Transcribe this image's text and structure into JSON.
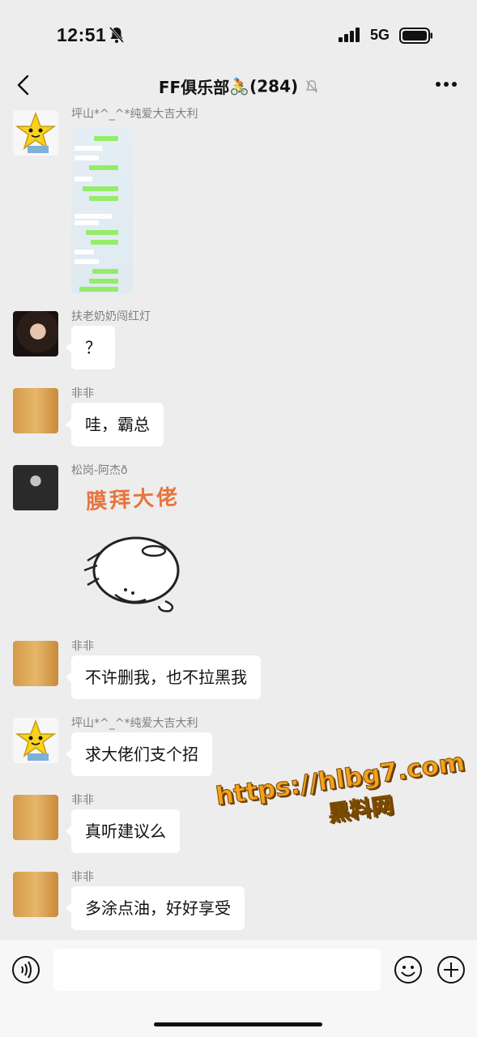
{
  "status_bar": {
    "time": "12:51",
    "network": "5G"
  },
  "header": {
    "group_name": "FF俱乐部",
    "member_count": "(284)",
    "emoji": "🚴"
  },
  "messages": [
    {
      "sender": "坪山*^_^*纯爱大吉大利",
      "type": "image",
      "avatar": "star-avatar"
    },
    {
      "sender": "扶老奶奶闯红灯",
      "type": "text",
      "text": "？",
      "avatar": "woman-avatar"
    },
    {
      "sender": "非非",
      "type": "text",
      "text": "哇，霸总",
      "avatar": "cat-avatar"
    },
    {
      "sender": "松岗-阿杰ð",
      "type": "sticker",
      "sticker_text": "膜拜大佬",
      "avatar": "man-avatar"
    },
    {
      "sender": "非非",
      "type": "text",
      "text": "不许删我，也不拉黑我",
      "avatar": "cat-avatar"
    },
    {
      "sender": "坪山*^_^*纯爱大吉大利",
      "type": "text",
      "text": "求大佬们支个招",
      "avatar": "star-avatar"
    },
    {
      "sender": "非非",
      "type": "text",
      "text": "真听建议么",
      "avatar": "cat-avatar"
    },
    {
      "sender": "非非",
      "type": "text",
      "text": "多涂点油，好好享受",
      "avatar": "cat-avatar"
    }
  ],
  "watermark": {
    "url": "https://hlbg7.com",
    "label": "黑料网"
  },
  "colors": {
    "background": "#ededed",
    "bubble": "#ffffff",
    "accent_green": "#95ec69",
    "watermark": "#f4a21e"
  }
}
